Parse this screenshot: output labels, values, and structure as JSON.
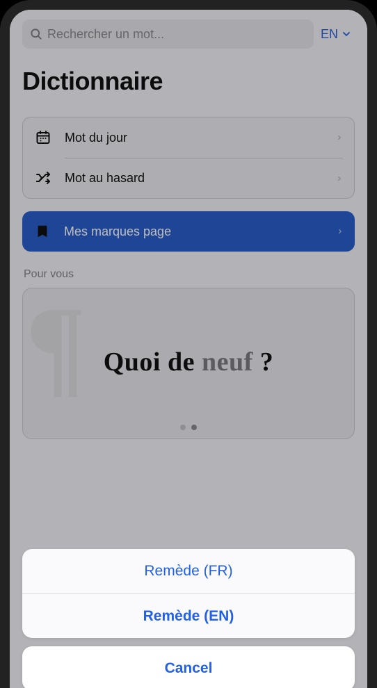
{
  "search": {
    "placeholder": "Rechercher un mot..."
  },
  "langSwitch": {
    "label": "EN"
  },
  "pageTitle": "Dictionnaire",
  "menu": {
    "wordOfDay": "Mot du jour",
    "randomWord": "Mot au hasard",
    "bookmarks": "Mes marques page"
  },
  "forYou": {
    "label": "Pour vous",
    "hero_prefix": "Quoi de ",
    "hero_grey": "neuf ",
    "hero_suffix": "?"
  },
  "actionSheet": {
    "options": [
      "Remède (FR)",
      "Remède (EN)"
    ],
    "cancel": "Cancel"
  },
  "colors": {
    "accent": "#2b5ecb",
    "link": "#2260e6"
  }
}
